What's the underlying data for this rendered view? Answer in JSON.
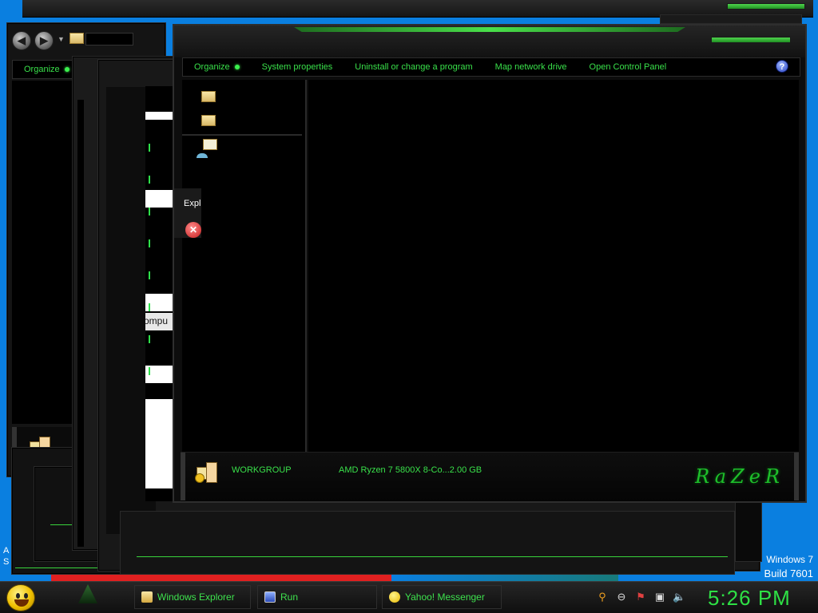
{
  "window_a": {
    "organize_label": "Organize"
  },
  "main_window": {
    "command_bar": {
      "organize": "Organize",
      "system_properties": "System properties",
      "uninstall": "Uninstall or change a program",
      "map_network": "Map network drive",
      "open_control_panel": "Open Control Panel",
      "help": "?"
    },
    "details": {
      "workgroup": "WORKGROUP",
      "processor": "AMD Ryzen 7 5800X 8-Co...2.00 GB"
    },
    "brand_logo": "RaZeR"
  },
  "popup": {
    "title_fragment": "Expl",
    "error_glyph": "✕"
  },
  "background_fragment": {
    "text": "ompu"
  },
  "desktop": {
    "corner_letters": [
      "A",
      "S"
    ],
    "watermark_line1": "Windows 7",
    "watermark_line2": "Build 7601"
  },
  "taskbar": {
    "buttons": [
      {
        "label": "Windows Explorer",
        "icon": "folder-icon"
      },
      {
        "label": "Run",
        "icon": "run-icon"
      },
      {
        "label": "Yahoo! Messenger",
        "icon": "yahoo-smiley-icon"
      }
    ],
    "tray_icons": [
      "search-icon",
      "status-icon",
      "action-center-flag-icon",
      "network-icon",
      "volume-icon"
    ],
    "clock": "5:26 PM"
  },
  "colors": {
    "accent_green": "#39e04a",
    "desktop_blue": "#0a7fe0",
    "window_black": "#000000"
  }
}
